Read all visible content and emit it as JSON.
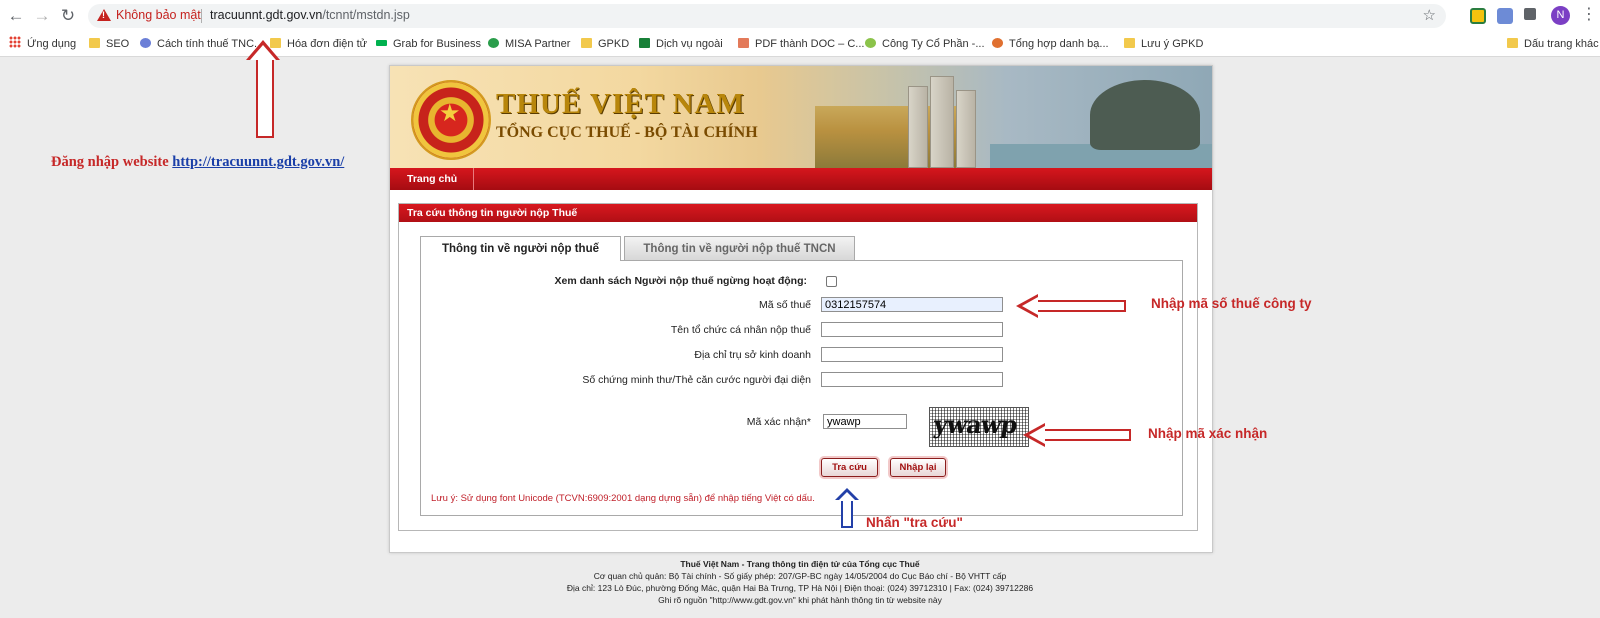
{
  "browser": {
    "insecure_label": "Không bảo mật",
    "url_host": "tracuunnt.gdt.gov.vn",
    "url_path": "/tcnnt/mstdn.jsp",
    "profile_initial": "N"
  },
  "bookmarks": {
    "items": [
      "Ứng dụng",
      "SEO",
      "Cách tính thuế TNC...",
      "Hóa đơn điện tử",
      "Grab for Business",
      "MISA Partner",
      "GPKD",
      "Dịch vụ ngoài",
      "PDF thành DOC – C...",
      "Công Ty Cổ Phần -...",
      "Tổng hợp danh bạ...",
      "Lưu ý GPKD"
    ],
    "other": "Dấu trang khác"
  },
  "annotations": {
    "login_text": "Đăng nhập website",
    "login_link": "http://tracuunnt.gdt.gov.vn/",
    "tax_code_note": "Nhập mã số thuế công ty",
    "captcha_note": "Nhập mã xác nhận",
    "search_note": "Nhấn \"tra cứu\"",
    "color_red": "#c62828",
    "color_blue": "#2340a8"
  },
  "site": {
    "title": "THUẾ VIỆT NAM",
    "subtitle": "TỔNG CỤC THUẾ - BỘ TÀI CHÍNH",
    "emblem_text": "THUẾ NHÀ NƯỚC",
    "nav_home": "Trang chủ",
    "section_title": "Tra cứu thông tin người nộp Thuế",
    "brand_color": "#c8161d"
  },
  "tabs": {
    "active": "Thông tin về người nộp thuế",
    "inactive": "Thông tin về người nộp thuế TNCN"
  },
  "form": {
    "inactive_list_label": "Xem danh sách Người nộp thuế ngừng hoạt động:",
    "tax_code_label": "Mã số thuế",
    "tax_code_value": "0312157574",
    "org_name_label": "Tên tổ chức cá nhân nộp thuế",
    "address_label": "Địa chỉ trụ sở kinh doanh",
    "id_label": "Số chứng minh thư/Thẻ căn cước người đại diện",
    "captcha_label": "Mã xác nhận*",
    "captcha_value": "ywawp",
    "captcha_image_text": "ywawp",
    "search_button": "Tra cứu",
    "reset_button": "Nhập lại",
    "hint": "Lưu ý: Sử dụng font Unicode (TCVN:6909:2001 dạng dựng sẵn) để nhập tiếng Việt có dấu."
  },
  "footer": {
    "line1": "Thuế Việt Nam - Trang thông tin điện tử của Tổng cục Thuế",
    "line2": "Cơ quan chủ quản: Bộ Tài chính - Số giấy phép: 207/GP-BC ngày 14/05/2004 do Cục Báo chí - Bộ VHTT cấp",
    "line3": "Địa chỉ: 123 Lò Đúc, phường Đống Mác, quận Hai Bà Trưng, TP Hà Nội | Điện thoại: (024) 39712310 | Fax: (024) 39712286",
    "line4": "Ghi rõ nguồn \"http://www.gdt.gov.vn\" khi phát hành thông tin từ website này"
  }
}
